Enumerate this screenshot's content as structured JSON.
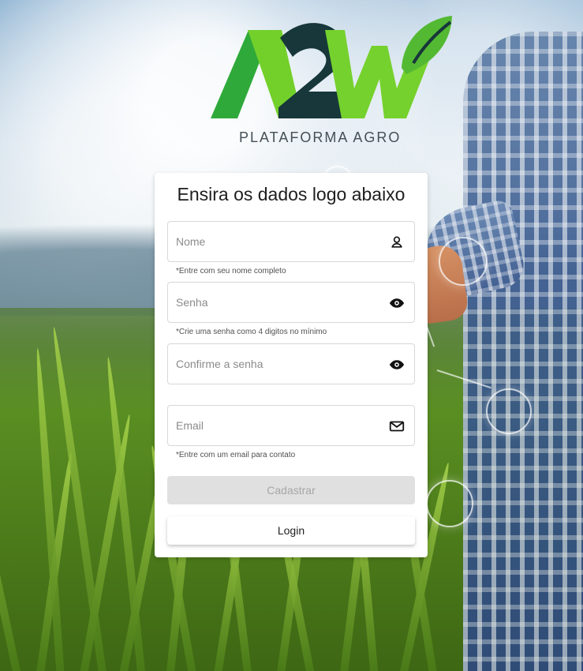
{
  "brand": {
    "logo_text": "A2W",
    "tagline": "PLATAFORMA AGRO"
  },
  "form": {
    "title": "Ensira os dados logo abaixo",
    "fields": [
      {
        "placeholder": "Nome",
        "value": "",
        "helper_text": "*Entre com seu nome completo",
        "icon": "user-icon"
      },
      {
        "placeholder": "Senha",
        "value": "",
        "helper_text": "*Crie uma senha como 4 digitos no mínimo",
        "icon": "eye-icon"
      },
      {
        "placeholder": "Confirme a senha",
        "value": "",
        "helper_text": "",
        "icon": "eye-icon"
      },
      {
        "placeholder": "Email",
        "value": "",
        "helper_text": "*Entre com um email para contato",
        "icon": "mail-icon"
      }
    ],
    "buttons": {
      "register_label": "Cadastrar",
      "login_label": "Login"
    }
  },
  "colors": {
    "brand_green": "#6ed12d",
    "brand_dark": "#17373a",
    "card_bg": "#ffffff",
    "disabled_button": "#e0e0e0"
  }
}
